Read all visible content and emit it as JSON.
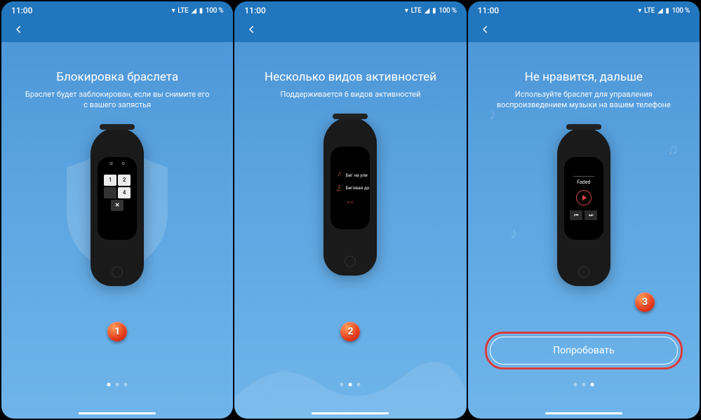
{
  "status": {
    "time": "11:00",
    "network": "LTE",
    "battery": "100 %"
  },
  "screens": [
    {
      "title": "Блокировка браслета",
      "subtitle": "Браслет будет заблокирован, если вы снимите его с вашего запястья",
      "badge": "1",
      "pageIndex": 0,
      "keypad": {
        "k1": "1",
        "k2": "2",
        "k4": "4",
        "kx": "✕"
      }
    },
    {
      "title": "Несколько видов активностей",
      "subtitle": "Поддерживается 6 видов активностей",
      "badge": "2",
      "pageIndex": 1,
      "activities": {
        "a1": "Бег на ули",
        "a2": "Беговая до"
      }
    },
    {
      "title": "Не нравится, дальше",
      "subtitle": "Используйте браслет для управления воспроизведением музыки на вашем телефоне",
      "badge": "3",
      "pageIndex": 2,
      "music": {
        "track": "Faded",
        "prev": "⏮",
        "next": "⏭"
      },
      "cta": "Попробовать"
    }
  ]
}
